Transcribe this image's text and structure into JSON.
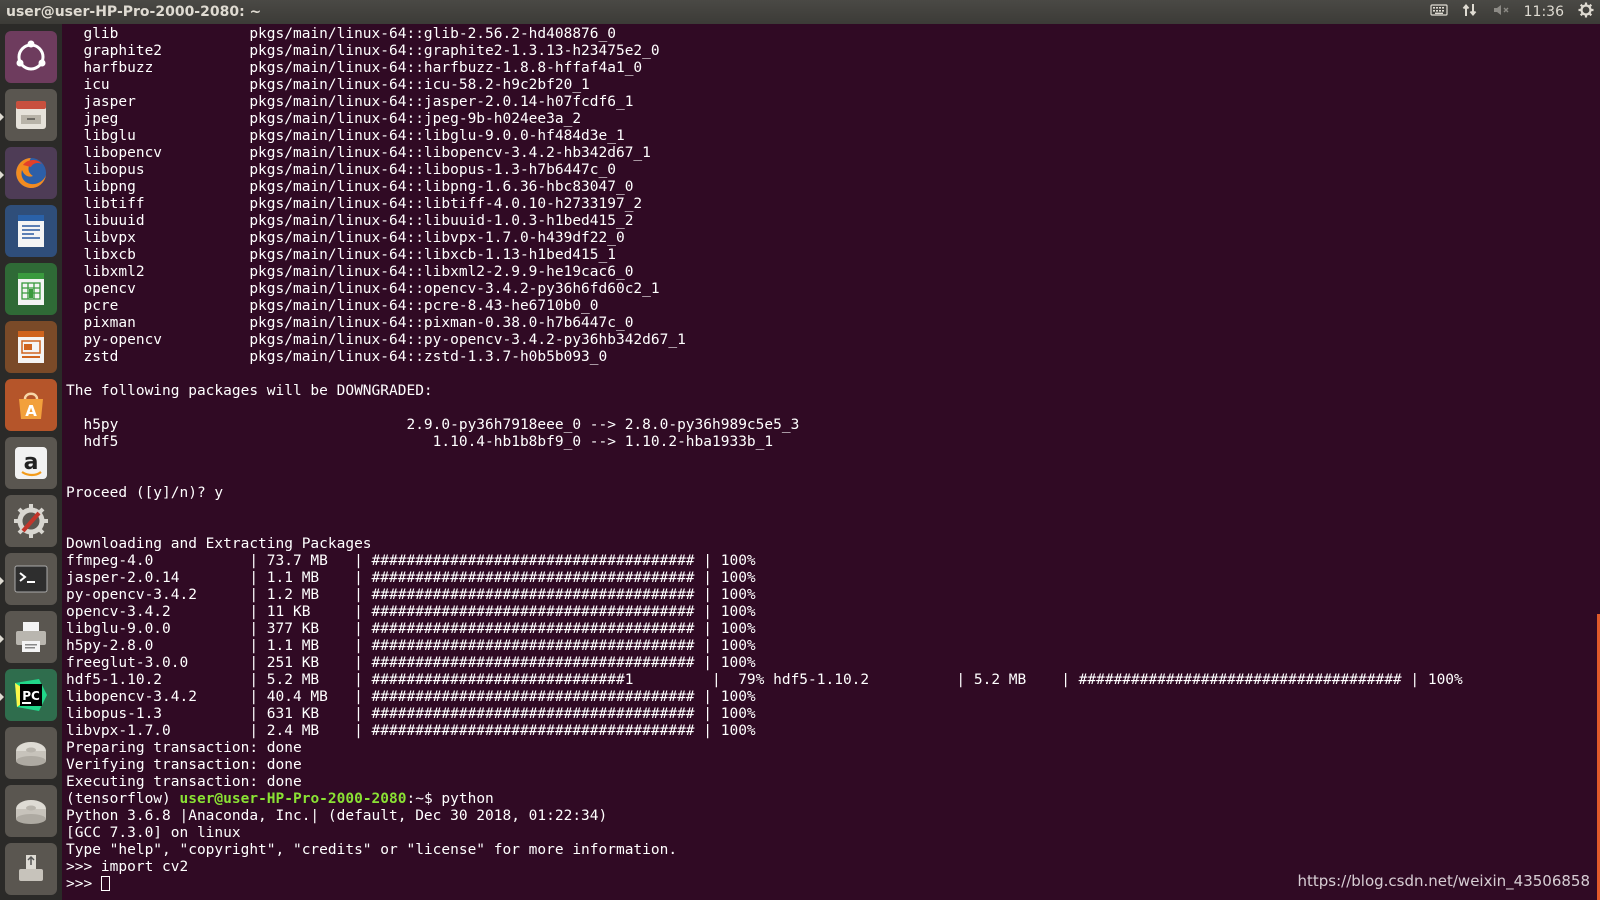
{
  "window": {
    "title": "user@user-HP-Pro-2000-2080: ~"
  },
  "indicators": {
    "clock": "11:36"
  },
  "launcher": [
    {
      "name": "ubuntu-dash-icon"
    },
    {
      "name": "files-icon"
    },
    {
      "name": "firefox-icon"
    },
    {
      "name": "writer-icon"
    },
    {
      "name": "calc-icon"
    },
    {
      "name": "impress-icon"
    },
    {
      "name": "software-center-icon"
    },
    {
      "name": "amazon-icon"
    },
    {
      "name": "system-settings-icon"
    },
    {
      "name": "terminal-icon"
    },
    {
      "name": "printer-icon"
    },
    {
      "name": "pycharm-icon"
    },
    {
      "name": "drive-icon"
    },
    {
      "name": "drive-icon"
    },
    {
      "name": "usb-drive-icon"
    }
  ],
  "terminal": {
    "lines_before_prompt": [
      "  glib               pkgs/main/linux-64::glib-2.56.2-hd408876_0",
      "  graphite2          pkgs/main/linux-64::graphite2-1.3.13-h23475e2_0",
      "  harfbuzz           pkgs/main/linux-64::harfbuzz-1.8.8-hffaf4a1_0",
      "  icu                pkgs/main/linux-64::icu-58.2-h9c2bf20_1",
      "  jasper             pkgs/main/linux-64::jasper-2.0.14-h07fcdf6_1",
      "  jpeg               pkgs/main/linux-64::jpeg-9b-h024ee3a_2",
      "  libglu             pkgs/main/linux-64::libglu-9.0.0-hf484d3e_1",
      "  libopencv          pkgs/main/linux-64::libopencv-3.4.2-hb342d67_1",
      "  libopus            pkgs/main/linux-64::libopus-1.3-h7b6447c_0",
      "  libpng             pkgs/main/linux-64::libpng-1.6.36-hbc83047_0",
      "  libtiff            pkgs/main/linux-64::libtiff-4.0.10-h2733197_2",
      "  libuuid            pkgs/main/linux-64::libuuid-1.0.3-h1bed415_2",
      "  libvpx             pkgs/main/linux-64::libvpx-1.7.0-h439df22_0",
      "  libxcb             pkgs/main/linux-64::libxcb-1.13-h1bed415_1",
      "  libxml2            pkgs/main/linux-64::libxml2-2.9.9-he19cac6_0",
      "  opencv             pkgs/main/linux-64::opencv-3.4.2-py36h6fd60c2_1",
      "  pcre               pkgs/main/linux-64::pcre-8.43-he6710b0_0",
      "  pixman             pkgs/main/linux-64::pixman-0.38.0-h7b6447c_0",
      "  py-opencv          pkgs/main/linux-64::py-opencv-3.4.2-py36hb342d67_1",
      "  zstd               pkgs/main/linux-64::zstd-1.3.7-h0b5b093_0",
      "",
      "The following packages will be DOWNGRADED:",
      "",
      "  h5py                                 2.9.0-py36h7918eee_0 --> 2.8.0-py36h989c5e5_3",
      "  hdf5                                    1.10.4-hb1b8bf9_0 --> 1.10.2-hba1933b_1",
      "",
      "",
      "Proceed ([y]/n)? y",
      "",
      "",
      "Downloading and Extracting Packages",
      "ffmpeg-4.0           | 73.7 MB   | ##################################### | 100% ",
      "jasper-2.0.14        | 1.1 MB    | ##################################### | 100% ",
      "py-opencv-3.4.2      | 1.2 MB    | ##################################### | 100% ",
      "opencv-3.4.2         | 11 KB     | ##################################### | 100% ",
      "libglu-9.0.0         | 377 KB    | ##################################### | 100% ",
      "h5py-2.8.0           | 1.1 MB    | ##################################### | 100% ",
      "freeglut-3.0.0       | 251 KB    | ##################################### | 100% ",
      "hdf5-1.10.2          | 5.2 MB    | #############################1         |  79% hdf5-1.10.2          | 5.2 MB    | ##################################### | 100% ",
      "libopencv-3.4.2      | 40.4 MB   | ##################################### | 100% ",
      "libopus-1.3          | 631 KB    | ##################################### | 100% ",
      "libvpx-1.7.0         | 2.4 MB    | ##################################### | 100% ",
      "Preparing transaction: done",
      "Verifying transaction: done",
      "Executing transaction: done"
    ],
    "prompt_env": "(tensorflow) ",
    "prompt_user": "user@user-HP-Pro-2000-2080",
    "prompt_path": ":~$ ",
    "prompt_command": "python",
    "lines_after_prompt": [
      "Python 3.6.8 |Anaconda, Inc.| (default, Dec 30 2018, 01:22:34) ",
      "[GCC 7.3.0] on linux",
      "Type \"help\", \"copyright\", \"credits\" or \"license\" for more information.",
      ">>> import cv2"
    ],
    "input_prompt": ">>> "
  },
  "watermark": "https://blog.csdn.net/weixin_43506858"
}
